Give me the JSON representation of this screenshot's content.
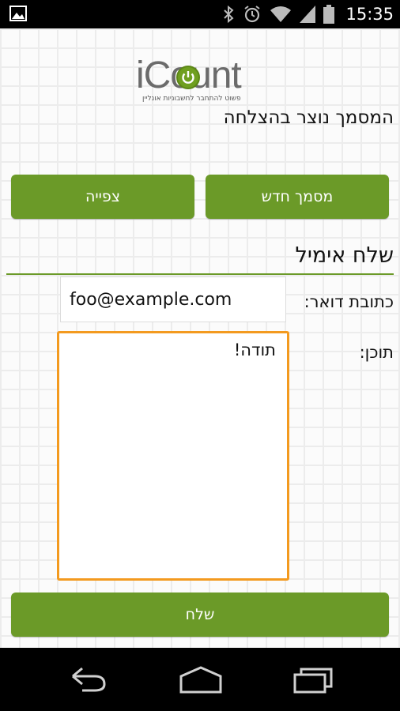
{
  "status_bar": {
    "time": "15:35",
    "icons": [
      "gallery-icon",
      "bluetooth-icon",
      "alarm-icon",
      "wifi-icon",
      "signal-icon",
      "battery-icon"
    ]
  },
  "app": {
    "logo_text": "iCount",
    "logo_tagline": "פשוט להתחבר לחשבוניות אונליין",
    "success_message": "המסמך נוצר בהצלחה",
    "buttons": {
      "new_document": "מסמך חדש",
      "view": "צפייה"
    },
    "send_email": {
      "title": "שלח אימיל",
      "email_label": "כתובת דואר:",
      "email_value": "foo@example.com",
      "content_label": "תוכן:",
      "content_value": "תודה!",
      "send_button": "שלח"
    },
    "colors": {
      "accent_green": "#6b9a28",
      "focus_orange": "#f39a1f"
    }
  },
  "nav_bar": {
    "icons": [
      "back-icon",
      "home-icon",
      "recent-apps-icon"
    ]
  }
}
